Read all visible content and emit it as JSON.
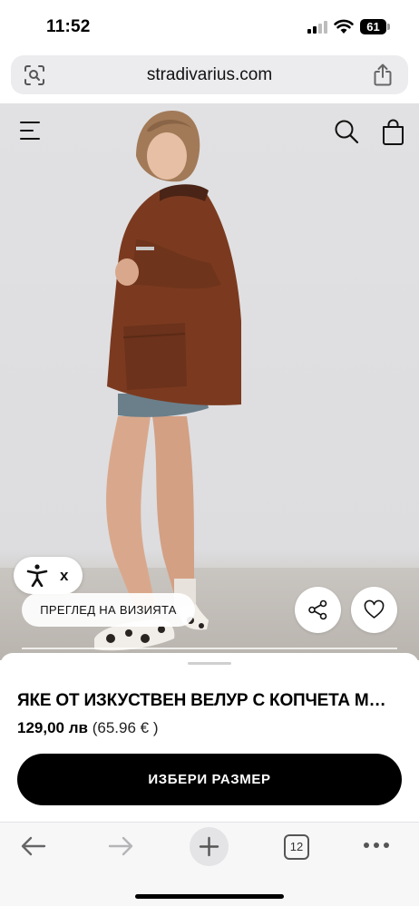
{
  "status_bar": {
    "time": "11:52",
    "battery_level": "61",
    "icons": [
      "signal-icon",
      "wifi-icon",
      "battery-icon"
    ]
  },
  "address_bar": {
    "url": "stradivarius.com",
    "icons": [
      "visual-lookup-icon",
      "share-icon"
    ]
  },
  "hero": {
    "icons": [
      "menu-icon",
      "search-icon",
      "shopping-bag-icon",
      "accessibility-icon",
      "share-icon",
      "heart-icon"
    ],
    "accessibility_close": "x",
    "visit_button_label": "ПРЕГЛЕД НА ВИЗИЯТА",
    "gallery_progress": 1.0
  },
  "product": {
    "title": "ЯКЕ ОТ ИЗКУСТВЕН ВЕЛУР С КОПЧЕТА МОНТГОМЪРИ",
    "price": "129,00 лв",
    "price_eur": "(65.96 € )",
    "cta_label": "ИЗБЕРИ РАЗМЕР"
  },
  "toolbar": {
    "tab_count": "12",
    "icons": [
      "back-arrow-icon",
      "forward-arrow-icon",
      "plus-icon",
      "tabs-icon",
      "more-icon"
    ]
  },
  "colors": {
    "cta_background": "#000000",
    "jacket": "#7b3a20",
    "backdrop": "#dfdfe1"
  }
}
